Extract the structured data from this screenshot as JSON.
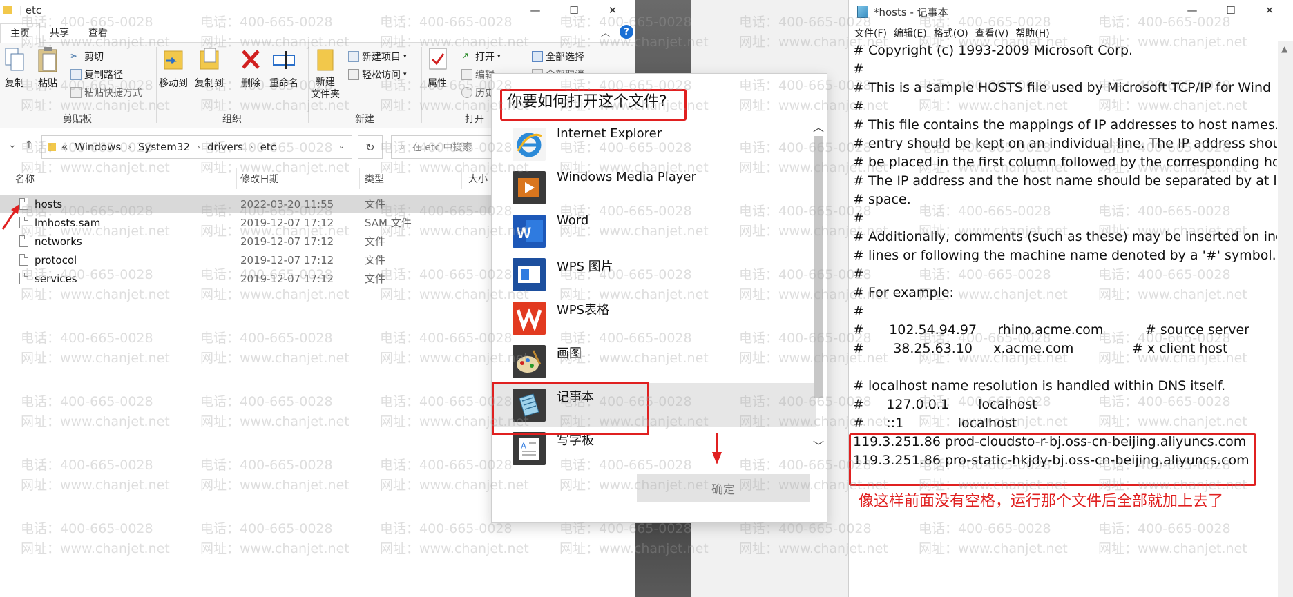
{
  "explorer": {
    "title": "etc",
    "tabs": [
      "主页",
      "共享",
      "查看"
    ],
    "ribbon": {
      "clipboard": {
        "label": "剪贴板",
        "copy": "复制",
        "paste": "粘贴",
        "cut": "剪切",
        "copy_path": "复制路径",
        "paste_shortcut": "粘贴快捷方式"
      },
      "organize": {
        "label": "组织",
        "move_to": "移动到",
        "copy_to": "复制到",
        "delete": "删除",
        "rename": "重命名"
      },
      "new": {
        "label": "新建",
        "new_folder": "新建\n文件夹",
        "new_item": "新建项目",
        "easy_access": "轻松访问"
      },
      "open": {
        "label": "打开",
        "properties": "属性",
        "open": "打开",
        "edit": "编辑",
        "history": "历史"
      },
      "select": {
        "select_all": "全部选择",
        "select_none": "全部取消"
      }
    },
    "address": {
      "crumbs": [
        "Windows",
        "System32",
        "drivers",
        "etc"
      ],
      "lead": "«"
    },
    "search": {
      "placeholder": "在 etc 中搜索"
    },
    "columns": {
      "name": "名称",
      "date": "修改日期",
      "type": "类型",
      "size": "大小"
    },
    "files": [
      {
        "name": "hosts",
        "date": "2022-03-20 11:55",
        "type": "文件",
        "selected": true
      },
      {
        "name": "lmhosts.sam",
        "date": "2019-12-07 17:12",
        "type": "SAM 文件",
        "selected": false
      },
      {
        "name": "networks",
        "date": "2019-12-07 17:12",
        "type": "文件",
        "selected": false
      },
      {
        "name": "protocol",
        "date": "2019-12-07 17:12",
        "type": "文件",
        "selected": false
      },
      {
        "name": "services",
        "date": "2019-12-07 17:12",
        "type": "文件",
        "selected": false
      }
    ]
  },
  "dialog": {
    "title": "你要如何打开这个文件?",
    "apps": [
      {
        "name": "Internet Explorer",
        "icon": "internet-explorer-icon"
      },
      {
        "name": "Windows Media Player",
        "icon": "media-player-icon"
      },
      {
        "name": "Word",
        "icon": "word-icon"
      },
      {
        "name": "WPS 图片",
        "icon": "wps-picture-icon"
      },
      {
        "name": "WPS表格",
        "icon": "wps-sheet-icon"
      },
      {
        "name": "画图",
        "icon": "paint-icon"
      },
      {
        "name": "记事本",
        "icon": "notepad-icon",
        "highlighted": true
      },
      {
        "name": "写字板",
        "icon": "wordpad-icon"
      }
    ],
    "ok_label": "确定"
  },
  "notepad": {
    "title": "*hosts - 记事本",
    "menu": [
      "文件(F)",
      "编辑(E)",
      "格式(O)",
      "查看(V)",
      "帮助(H)"
    ],
    "lines": [
      "# Copyright (c) 1993-2009 Microsoft Corp.",
      "#",
      "# This is a sample HOSTS file used by Microsoft TCP/IP for Wind",
      "#",
      "# This file contains the mappings of IP addresses to host names.",
      "# entry should be kept on an individual line. The IP address shou",
      "# be placed in the first column followed by the corresponding ho",
      "# The IP address and the host name should be separated by at le",
      "# space.",
      "#",
      "# Additionally, comments (such as these) may be inserted on inc",
      "# lines or following the machine name denoted by a '#' symbol.",
      "#",
      "# For example:",
      "#",
      "#      102.54.94.97     rhino.acme.com          # source server",
      "#       38.25.63.10     x.acme.com              # x client host",
      "",
      "# localhost name resolution is handled within DNS itself.",
      "#\t127.0.0.1       localhost",
      "#\t::1             localhost",
      "119.3.251.86 prod-cloudsto-r-bj.oss-cn-beijing.aliyuncs.com",
      "119.3.251.86 pro-static-hkjdy-bj.oss-cn-beijing.aliyuncs.com"
    ],
    "annotation": "像这样前面没有空格，运行那个文件后全部就加上去了"
  },
  "watermark": {
    "phone": "电话：400-665-0028",
    "site": "网址：www.chanjet.net"
  },
  "colors": {
    "accent_red": "#e02020",
    "selection": "#d9d9d9"
  }
}
